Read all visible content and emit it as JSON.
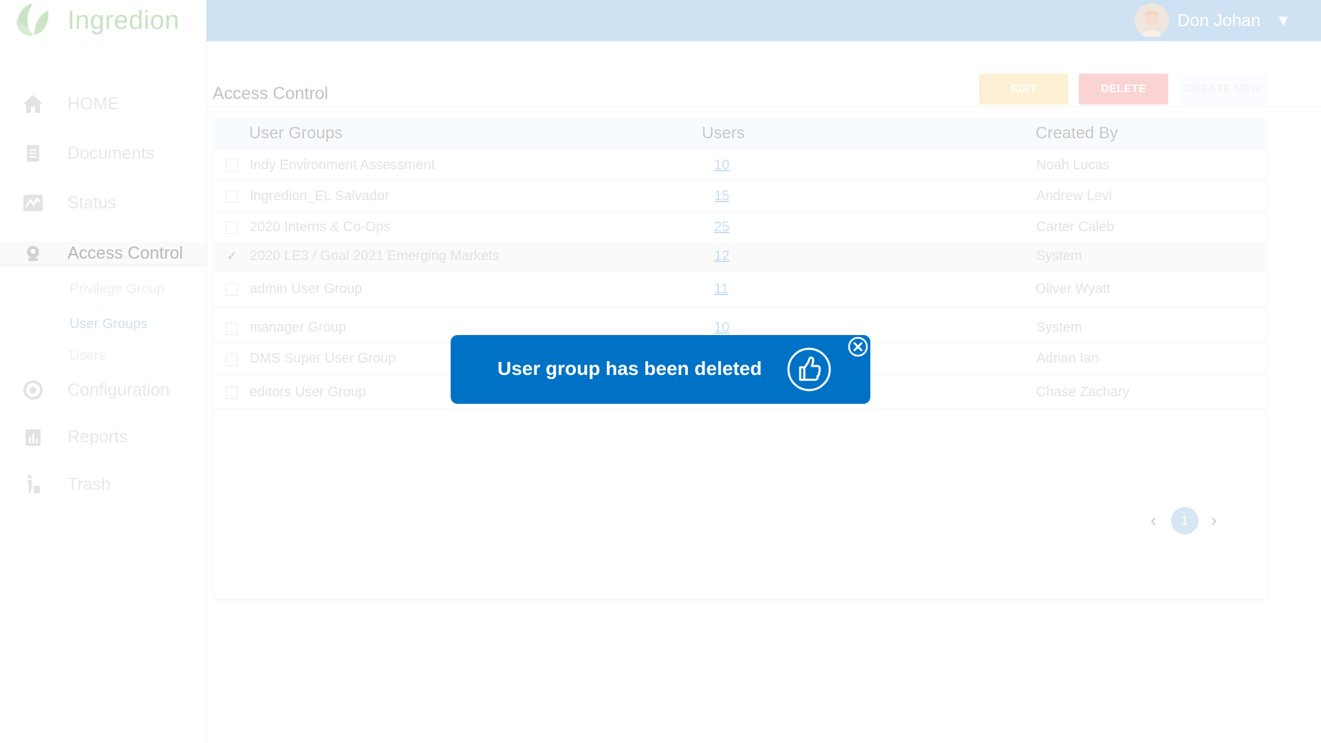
{
  "brand": {
    "name": "Ingredion",
    "logo_icon": "leaf-logo-icon"
  },
  "user": {
    "name": "Don Johan",
    "caret": "▼"
  },
  "colors": {
    "topbar": "#cfe2f3",
    "toast": "#0072c6",
    "edit": "#fdf0d4",
    "delete": "#fbd3d3",
    "link": "#c8def2"
  },
  "sidebar": {
    "items": [
      {
        "label": "HOME",
        "icon": "home-icon"
      },
      {
        "label": "Documents",
        "icon": "document-icon"
      },
      {
        "label": "Status",
        "icon": "status-chart-icon"
      },
      {
        "label": "Access Control",
        "icon": "access-control-icon",
        "active": true
      },
      {
        "label": "Configuration",
        "icon": "configuration-icon"
      },
      {
        "label": "Reports",
        "icon": "reports-icon"
      },
      {
        "label": "Trash",
        "icon": "trash-icon"
      }
    ],
    "subitems": [
      {
        "label": "Privilege Group"
      },
      {
        "label": "User Groups",
        "active": true
      },
      {
        "label": "Users"
      }
    ]
  },
  "page": {
    "title": "Access Control"
  },
  "actions": {
    "edit": "EDIT",
    "delete": "DELETE",
    "create": "CREATE NEW"
  },
  "table": {
    "headers": {
      "group": "User Groups",
      "users": "Users",
      "created_by": "Created By"
    },
    "rows": [
      {
        "group": "Indy Environment Assessment",
        "users": "10",
        "created_by": "Noah Lucas",
        "checked": false
      },
      {
        "group": "Ingredion_EL Salvador",
        "users": "15",
        "created_by": "Andrew Levi",
        "checked": false
      },
      {
        "group": "2020 Interns & Co-Ops",
        "users": "25",
        "created_by": "Carter Caleb",
        "checked": false
      },
      {
        "group": "2020 LE3 / Goal 2021 Emerging Markets",
        "users": "12",
        "created_by": "System",
        "checked": true
      },
      {
        "group": "admin User Group",
        "users": "11",
        "created_by": "Oliver Wyatt",
        "checked": false
      },
      {
        "group": "manager Group",
        "users": "10",
        "created_by": "System",
        "checked": false
      },
      {
        "group": "DMS Super User Group",
        "users": "",
        "created_by": "Adrian Ian",
        "checked": false
      },
      {
        "group": "editors User Group",
        "users": "",
        "created_by": "Chase Zachary",
        "checked": false
      }
    ]
  },
  "pagination": {
    "current": "1",
    "prev": "‹",
    "next": "›"
  },
  "toast": {
    "message": "User group has been deleted",
    "icon": "thumbs-up-icon",
    "close_icon": "close-circle-icon"
  }
}
